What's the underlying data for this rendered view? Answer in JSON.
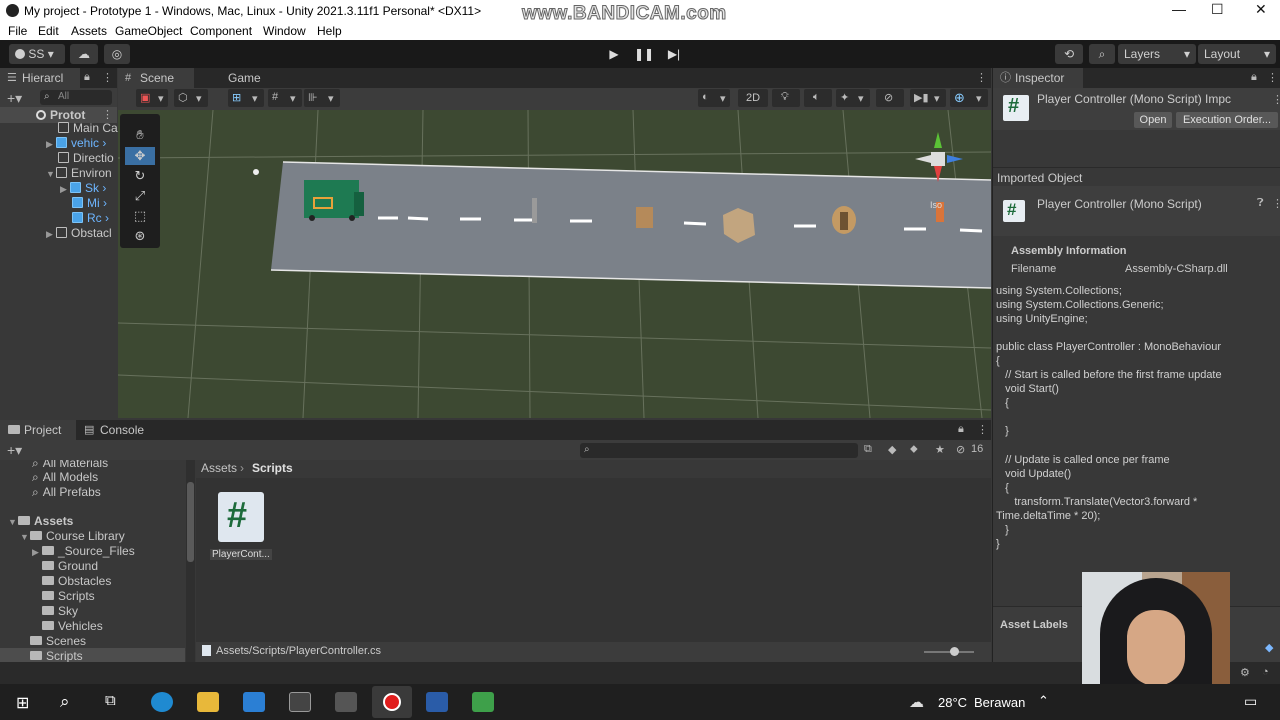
{
  "window": {
    "title": "My project - Prototype 1 - Windows, Mac, Linux - Unity 2021.3.11f1 Personal* <DX11>",
    "watermark": "www.BANDICAM.com",
    "minimize": "—",
    "maximize": "☐",
    "close": "✕"
  },
  "menu": [
    "File",
    "Edit",
    "Assets",
    "GameObject",
    "Component",
    "Window",
    "Help"
  ],
  "toolbar": {
    "account": "SS",
    "layers_label": "Layers",
    "layout_label": "Layout"
  },
  "hierarchy": {
    "tab": "Hierarcl",
    "search_placeholder": "All",
    "items": [
      {
        "label": "Protot",
        "kind": "scene"
      },
      {
        "label": "Main Ca",
        "kind": "object"
      },
      {
        "label": "vehic",
        "kind": "prefab"
      },
      {
        "label": "Directio",
        "kind": "object"
      },
      {
        "label": "Environ",
        "kind": "object"
      },
      {
        "label": "Sk",
        "kind": "prefab"
      },
      {
        "label": "Mi",
        "kind": "prefab"
      },
      {
        "label": "Rc",
        "kind": "prefab"
      },
      {
        "label": "Obstacl",
        "kind": "object"
      }
    ]
  },
  "scene": {
    "tab_scene": "Scene",
    "tab_game": "Game",
    "mode_2d": "2D",
    "persp_label": "Iso"
  },
  "project": {
    "tab_project": "Project",
    "tab_console": "Console",
    "hidden_count": "16",
    "favorites": [
      "All Materials",
      "All Models",
      "All Prefabs"
    ],
    "tree": [
      {
        "label": "Assets",
        "level": 0,
        "bold": true
      },
      {
        "label": "Course Library",
        "level": 1
      },
      {
        "label": "_Source_Files",
        "level": 2
      },
      {
        "label": "Ground",
        "level": 2
      },
      {
        "label": "Obstacles",
        "level": 2
      },
      {
        "label": "Scripts",
        "level": 2
      },
      {
        "label": "Sky",
        "level": 2
      },
      {
        "label": "Vehicles",
        "level": 2
      },
      {
        "label": "Scenes",
        "level": 1
      },
      {
        "label": "Scripts",
        "level": 1,
        "selected": true
      }
    ],
    "breadcrumb_root": "Assets",
    "breadcrumb_current": "Scripts",
    "asset_name": "PlayerCont...",
    "asset_icon": "#",
    "status_path": "Assets/Scripts/PlayerController.cs"
  },
  "inspector": {
    "tab": "Inspector",
    "header_title": "Player Controller (Mono Script) Impc",
    "open_button": "Open",
    "exec_order_button": "Execution Order...",
    "imported_object": "Imported Object",
    "sub_title": "Player Controller (Mono Script)",
    "assembly_header": "Assembly Information",
    "filename_label": "Filename",
    "filename_value": "Assembly-CSharp.dll",
    "code": [
      "using System.Collections;",
      "using System.Collections.Generic;",
      "using UnityEngine;",
      "",
      "public class PlayerController : MonoBehaviour",
      "{",
      "   // Start is called before the first frame update",
      "   void Start()",
      "   {",
      "",
      "   }",
      "",
      "   // Update is called once per frame",
      "   void Update()",
      "   {",
      "      transform.Translate(Vector3.forward *",
      "Time.deltaTime * 20);",
      "   }",
      "}"
    ],
    "asset_labels": "Asset Labels"
  },
  "taskbar": {
    "weather_temp": "28°C",
    "weather_text": "Berawan"
  },
  "colors": {
    "accent_blue": "#2c5d87",
    "road": "#8a9097",
    "grass": "#414c36",
    "csharp_green": "#1d6b3b"
  }
}
